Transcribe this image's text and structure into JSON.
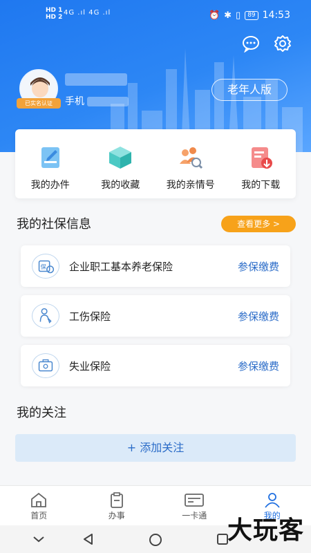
{
  "status_bar": {
    "hd1": "HD 1",
    "hd2": "HD 2",
    "signal": "4G .ıl 4G .ıl",
    "battery": "89",
    "time": "14:53"
  },
  "header": {
    "verified_label": "已实名认证",
    "phone_prefix": "手机",
    "elder_mode": "老年人版"
  },
  "quick_actions": [
    {
      "label": "我的办件",
      "icon": "document-edit-icon"
    },
    {
      "label": "我的收藏",
      "icon": "cube-icon"
    },
    {
      "label": "我的亲情号",
      "icon": "family-search-icon"
    },
    {
      "label": "我的下载",
      "icon": "download-icon"
    }
  ],
  "social_security": {
    "title": "我的社保信息",
    "more": "查看更多 >",
    "items": [
      {
        "name": "企业职工基本养老保险",
        "action": "参保缴费",
        "icon": "pension-icon"
      },
      {
        "name": "工伤保险",
        "action": "参保缴费",
        "icon": "injury-icon"
      },
      {
        "name": "失业保险",
        "action": "参保缴费",
        "icon": "unemployment-icon"
      }
    ]
  },
  "follow": {
    "title": "我的关注",
    "add": "+ 添加关注"
  },
  "tabbar": [
    {
      "label": "首页",
      "icon": "home-icon"
    },
    {
      "label": "办事",
      "icon": "clipboard-icon"
    },
    {
      "label": "一卡通",
      "icon": "card-icon"
    },
    {
      "label": "我的",
      "icon": "person-icon",
      "active": true
    }
  ],
  "watermark": "大玩客"
}
